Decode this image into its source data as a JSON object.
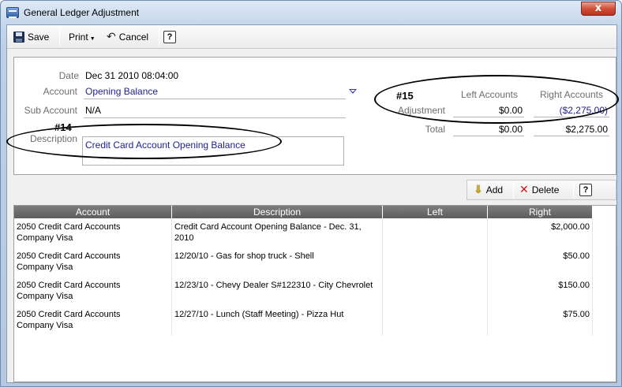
{
  "window": {
    "title": "General Ledger Adjustment",
    "close_label": "x"
  },
  "toolbar": {
    "save": "Save",
    "print": "Print",
    "cancel": "Cancel",
    "help": "?"
  },
  "form": {
    "date_label": "Date",
    "date_value": "Dec 31 2010 08:04:00",
    "account_label": "Account",
    "account_value": "Opening Balance",
    "subaccount_label": "Sub Account",
    "subaccount_value": "N/A",
    "description_label": "Description",
    "description_value": "Credit Card Account Opening Balance"
  },
  "totals": {
    "left_header": "Left Accounts",
    "right_header": "Right Accounts",
    "adjustment_label": "Adjustment",
    "adjustment_left": "$0.00",
    "adjustment_right": "($2,275.00)",
    "total_label": "Total",
    "total_left": "$0.00",
    "total_right": "$2,275.00"
  },
  "annotations": {
    "a14": "#14",
    "a15": "#15"
  },
  "grid_toolbar": {
    "add": "Add",
    "delete": "Delete",
    "help": "?"
  },
  "grid": {
    "columns": [
      "Account",
      "Description",
      "Left",
      "Right"
    ],
    "rows": [
      {
        "account": "2050 Credit Card Accounts",
        "sub": "Company Visa",
        "description": "Credit Card Account Opening Balance - Dec. 31, 2010",
        "left": "",
        "right": "$2,000.00"
      },
      {
        "account": "2050 Credit Card Accounts",
        "sub": "Company Visa",
        "description": "12/20/10 - Gas for shop truck - Shell",
        "left": "",
        "right": "$50.00"
      },
      {
        "account": "2050 Credit Card Accounts",
        "sub": "Company Visa",
        "description": "12/23/10 - Chevy Dealer S#122310 - City Chevrolet",
        "left": "",
        "right": "$150.00"
      },
      {
        "account": "2050 Credit Card Accounts",
        "sub": "Company Visa",
        "description": "12/27/10 - Lunch (Staff Meeting) - Pizza Hut",
        "left": "",
        "right": "$75.00"
      }
    ]
  }
}
